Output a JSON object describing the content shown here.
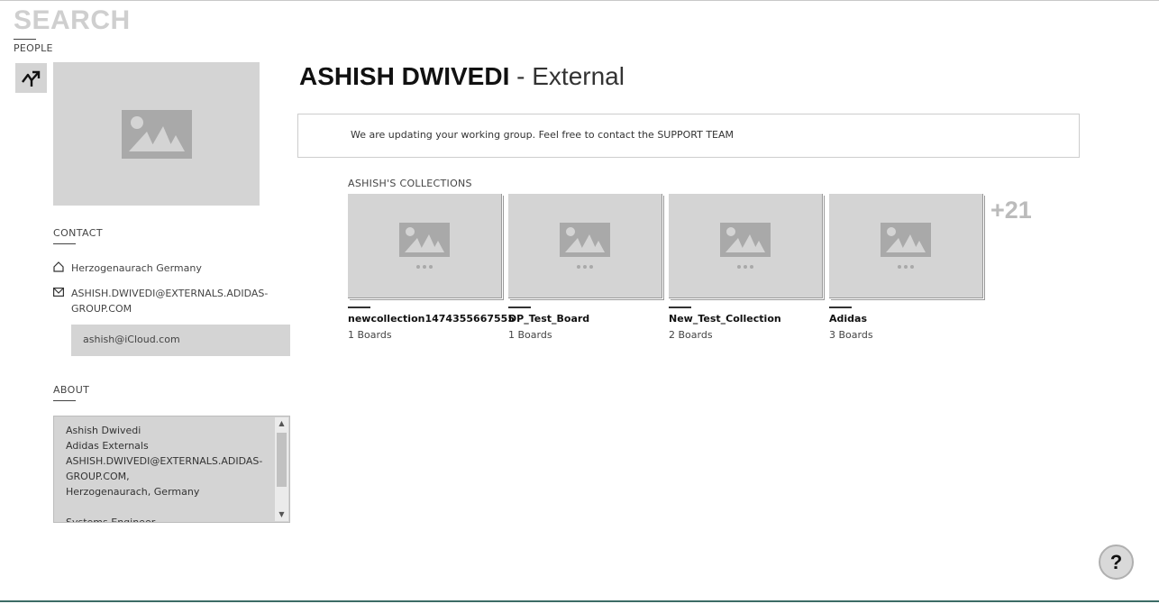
{
  "header": {
    "title": "SEARCH",
    "subtitle": "PEOPLE"
  },
  "toggle": {
    "icon": "trending-toggle-icon"
  },
  "sidebar": {
    "contact_label": "CONTACT",
    "location": "Herzogenaurach Germany",
    "email": "ASHISH.DWIVEDI@EXTERNALS.ADIDAS-GROUP.COM",
    "alt_email": "ashish@iCloud.com",
    "about_label": "ABOUT",
    "about_text": "Ashish Dwivedi\nAdidas Externals\nASHISH.DWIVEDI@EXTERNALS.ADIDAS-GROUP.COM,\nHerzogenaurach, Germany\n\nSystems Engineer"
  },
  "profile": {
    "name": "ASHISH DWIVEDI",
    "role": "- External"
  },
  "notice": "We are updating your working group. Feel free to contact the SUPPORT TEAM",
  "collections": {
    "heading": "ASHISH'S COLLECTIONS",
    "items": [
      {
        "name": "newcollection1474355667555",
        "count": "1 Boards"
      },
      {
        "name": "DP_Test_Board",
        "count": "1 Boards"
      },
      {
        "name": "New_Test_Collection",
        "count": "2 Boards"
      },
      {
        "name": "Adidas",
        "count": "3 Boards"
      }
    ],
    "more": "+21"
  },
  "help": {
    "label": "?"
  },
  "colors": {
    "placeholder": "#d4d4d4",
    "icon": "#a9a9a9",
    "accent_line": "#3c6b66"
  }
}
